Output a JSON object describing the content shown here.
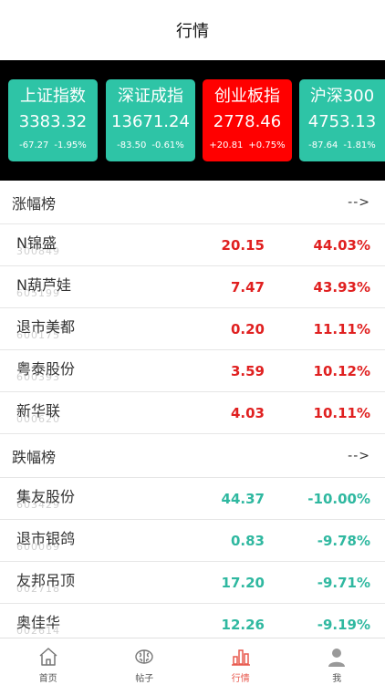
{
  "header": {
    "title": "行情"
  },
  "colors": {
    "up_card": "#2ec4a6",
    "red_card": "#ff0000",
    "up": "#e02020",
    "down": "#2fb8a0",
    "active_tab": "#e85a4f"
  },
  "indices": [
    {
      "name": "上证指数",
      "value": "3383.32",
      "change": "-67.27",
      "percent": "-1.95%",
      "color": "#2ec4a6"
    },
    {
      "name": "深证成指",
      "value": "13671.24",
      "change": "-83.50",
      "percent": "-0.61%",
      "color": "#2ec4a6"
    },
    {
      "name": "创业板指",
      "value": "2778.46",
      "change": "+20.81",
      "percent": "+0.75%",
      "color": "#ff0000"
    },
    {
      "name": "沪深300",
      "value": "4753.13",
      "change": "-87.64",
      "percent": "-1.81%",
      "color": "#2ec4a6"
    }
  ],
  "gainers": {
    "title": "涨幅榜",
    "more": "-->",
    "rows": [
      {
        "name": "N锦盛",
        "code": "300849",
        "price": "20.15",
        "percent": "44.03%"
      },
      {
        "name": "N葫芦娃",
        "code": "605199",
        "price": "7.47",
        "percent": "43.93%"
      },
      {
        "name": "退市美都",
        "code": "600175",
        "price": "0.20",
        "percent": "11.11%"
      },
      {
        "name": "粤泰股份",
        "code": "600393",
        "price": "3.59",
        "percent": "10.12%"
      },
      {
        "name": "新华联",
        "code": "000620",
        "price": "4.03",
        "percent": "10.11%"
      }
    ]
  },
  "losers": {
    "title": "跌幅榜",
    "more": "-->",
    "rows": [
      {
        "name": "集友股份",
        "code": "603429",
        "price": "44.37",
        "percent": "-10.00%"
      },
      {
        "name": "退市银鸽",
        "code": "600069",
        "price": "0.83",
        "percent": "-9.78%"
      },
      {
        "name": "友邦吊顶",
        "code": "002718",
        "price": "17.20",
        "percent": "-9.71%"
      },
      {
        "name": "奥佳华",
        "code": "002614",
        "price": "12.26",
        "percent": "-9.19%"
      }
    ]
  },
  "tabbar": {
    "items": [
      {
        "label": "首页",
        "icon": "home-icon"
      },
      {
        "label": "帖子",
        "icon": "brain-icon"
      },
      {
        "label": "行情",
        "icon": "bar-chart-icon"
      },
      {
        "label": "我",
        "icon": "user-icon"
      }
    ]
  }
}
